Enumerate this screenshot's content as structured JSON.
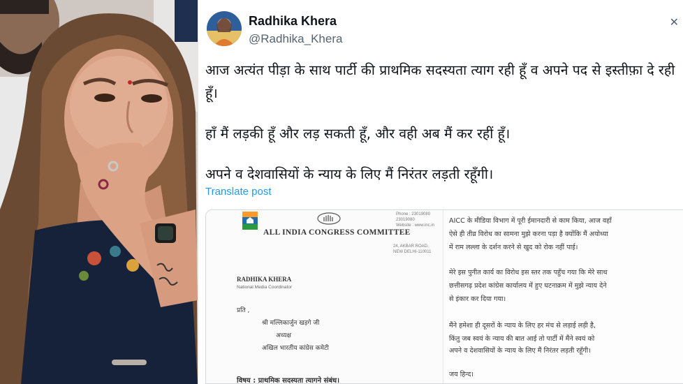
{
  "tweet": {
    "author_name": "Radhika Khera",
    "author_handle": "@Radhika_Khera",
    "paragraphs": [
      "आज अत्यंत पीड़ा के साथ पार्टी की प्राथमिक सदस्यता त्याग रही हूँ व अपने पद से इस्तीफ़ा दे रही हूँ।",
      "हाँ मैं लड़की हूँ और लड़ सकती हूँ, और वही अब मैं कर रहीं हूँ।",
      "अपने व देशवासियों के न्याय के लिए मैं निरंतर लड़ती रहूँगी।"
    ],
    "translate_label": "Translate post"
  },
  "letter": {
    "phone": "Phone : 23019080\n23019080\nWebsite : www.inc.in",
    "title": "ALL INDIA CONGRESS COMMITTEE",
    "address": "24, AKBAR ROAD,\nNEW DELHI-110011",
    "sender_name": "RADHIKA KHERA",
    "sender_title": "National Media Coordinator",
    "to_label": "प्रति ,",
    "to_lines": [
      "श्री मल्लिकार्जुन खड़गे जी",
      "अध्यक्ष",
      "अखिल भारतीय कांग्रेस कमेटी"
    ],
    "subject": "विषय : प्राथमिक सदस्यता त्यागने संबंध।",
    "right_lines": [
      "AICC के मीडिया विभाग में पूरी ईमानदारी से काम किया, आज वहाँ",
      "ऐसे ही तीव्र विरोध का सामना मुझे करना पड़ा है क्योंकि मैं अयोध्या",
      "में राम लल्ला के दर्शन करने से खुद को रोक नहीं पाई।",
      "मेरे इस पुनीत कार्य का विरोध इस स्तर तक पहुँच गया कि मेरे साथ",
      "छत्तीसगढ़ प्रदेश कांग्रेस कार्यालय में हुए घटनाक्रम में मुझे न्याय देने",
      "से इंकार कर दिया गया।",
      "मैंने हमेशा ही दूसरों के न्याय के लिए हर मंच से लड़ाई लड़ी है,",
      "किंतु जब स्वयं के न्याय की बात आई तो पार्टी में मैंने स्वयं को",
      "अपने व देशवासियों के न्याय के लिए मैं निरंतर लड़ती रहूँगी।",
      "जय हिन्द।"
    ]
  },
  "colors": {
    "text": "#0f1419",
    "handle": "#536471",
    "link": "#1d9bf0"
  },
  "icons": {
    "close": "close-icon"
  }
}
